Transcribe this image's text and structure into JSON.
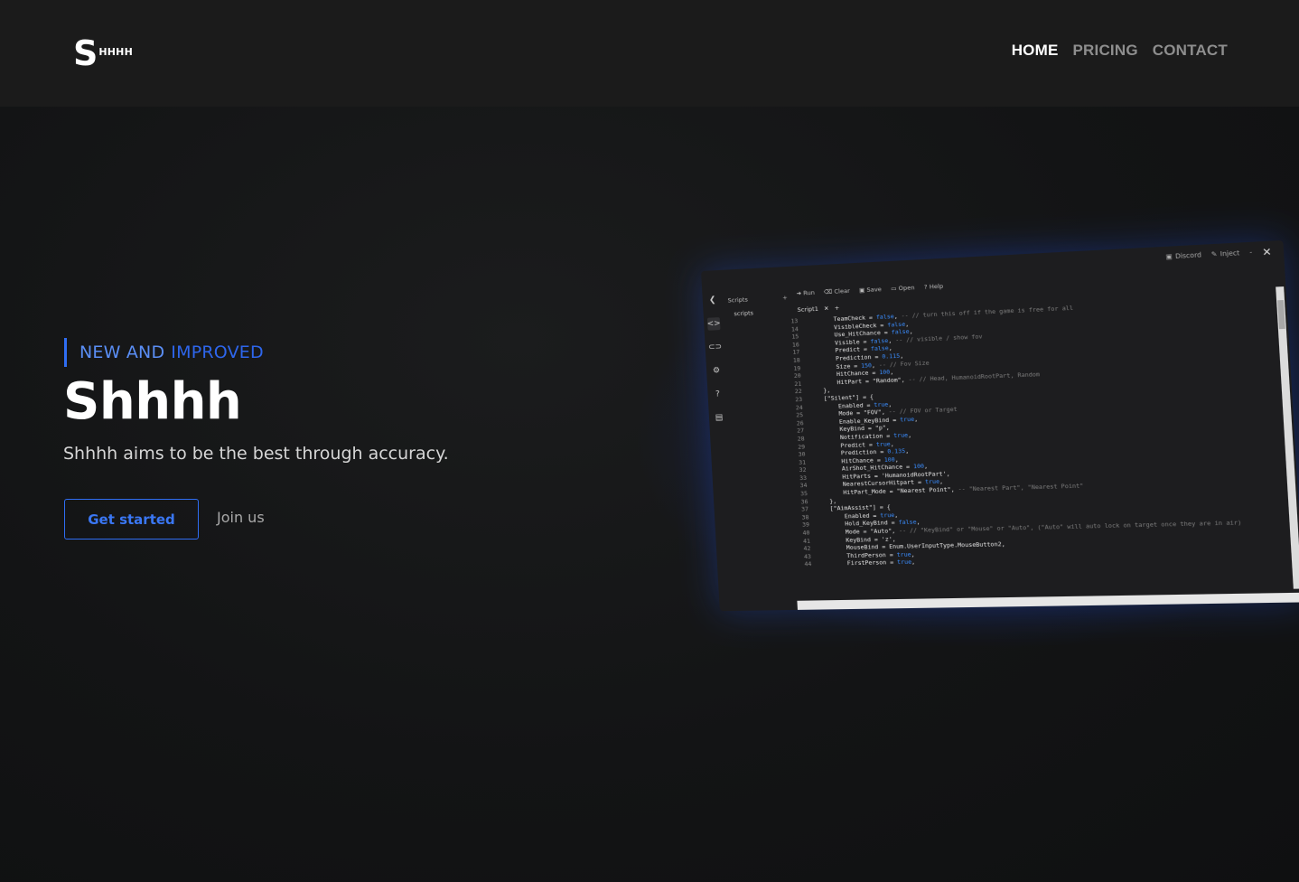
{
  "header": {
    "logo_initial": "S",
    "logo_rest": "HHHH",
    "nav": [
      {
        "label": "HOME",
        "active": true
      },
      {
        "label": "PRICING",
        "active": false
      },
      {
        "label": "CONTACT",
        "active": false
      }
    ]
  },
  "hero": {
    "eyebrow_word1": "NEW AND",
    "eyebrow_word2": "IMPROVED",
    "title": "Shhhh",
    "subtitle": "Shhhh aims to be the best through accuracy.",
    "primary_button": "Get started",
    "secondary_link": "Join us"
  },
  "editor": {
    "titlebar": {
      "discord": "Discord",
      "inject": "Inject",
      "minimize": "-",
      "close": "✕"
    },
    "panel_title": "Scripts",
    "panel_add": "+",
    "panel_file": "scripts",
    "toolbar": [
      "Run",
      "Clear",
      "Save",
      "Open",
      "Help"
    ],
    "tab": {
      "name": "Script1",
      "close": "✕",
      "add": "+"
    },
    "code_lines": [
      {
        "n": "13",
        "t": "        TeamCheck = false, -- // turn this off if the game is free for all"
      },
      {
        "n": "14",
        "t": "        VisibleCheck = false,"
      },
      {
        "n": "15",
        "t": "        Use_HitChance = false,"
      },
      {
        "n": "16",
        "t": "        Visible = false, -- // visible / show fov"
      },
      {
        "n": "17",
        "t": "        Predict = false,"
      },
      {
        "n": "18",
        "t": "        Prediction = 0.115,"
      },
      {
        "n": "19",
        "t": "        Size = 150, -- // Fov Size"
      },
      {
        "n": "20",
        "t": "        HitChance = 100,"
      },
      {
        "n": "21",
        "t": "        HitPart = \"Random\", -- // Head, HumanoidRootPart, Random"
      },
      {
        "n": "22",
        "t": "    },"
      },
      {
        "n": "23",
        "t": "    [\"Silent\"] = {"
      },
      {
        "n": "24",
        "t": "        Enabled = true,"
      },
      {
        "n": "25",
        "t": "        Mode = \"FOV\", -- // FOV or Target"
      },
      {
        "n": "26",
        "t": "        Enable_KeyBind = true,"
      },
      {
        "n": "27",
        "t": "        KeyBind = \"p\","
      },
      {
        "n": "28",
        "t": "        Notification = true,"
      },
      {
        "n": "29",
        "t": "        Predict = true,"
      },
      {
        "n": "30",
        "t": "        Prediction = 0.135,"
      },
      {
        "n": "31",
        "t": "        HitChance = 100,"
      },
      {
        "n": "32",
        "t": "        AirShot_HitChance = 100,"
      },
      {
        "n": "33",
        "t": "        HitParts = 'HumanoidRootPart',"
      },
      {
        "n": "34",
        "t": "        NearestCursorHitpart = true,"
      },
      {
        "n": "35",
        "t": "        HitPart_Mode = \"Nearest Point\", -- \"Nearest Part\", \"Nearest Point\""
      },
      {
        "n": "36",
        "t": "    },"
      },
      {
        "n": "37",
        "t": "    [\"AimAssist\"] = {"
      },
      {
        "n": "38",
        "t": "        Enabled = true,"
      },
      {
        "n": "39",
        "t": "        Hold_KeyBind = false,"
      },
      {
        "n": "40",
        "t": "        Mode = \"Auto\", -- // \"KeyBind\" or \"Mouse\" or \"Auto\", (\"Auto\" will auto lock on target once they are in air)"
      },
      {
        "n": "41",
        "t": "        KeyBind = 'z',"
      },
      {
        "n": "42",
        "t": "        MouseBind = Enum.UserInputType.MouseButton2,"
      },
      {
        "n": "43",
        "t": "        ThirdPerson = true,"
      },
      {
        "n": "44",
        "t": "        FirstPerson = true,"
      }
    ]
  },
  "colors": {
    "accent_blue": "#2f6df2",
    "header_bg": "#1b1b1b",
    "page_bg": "#121314"
  }
}
